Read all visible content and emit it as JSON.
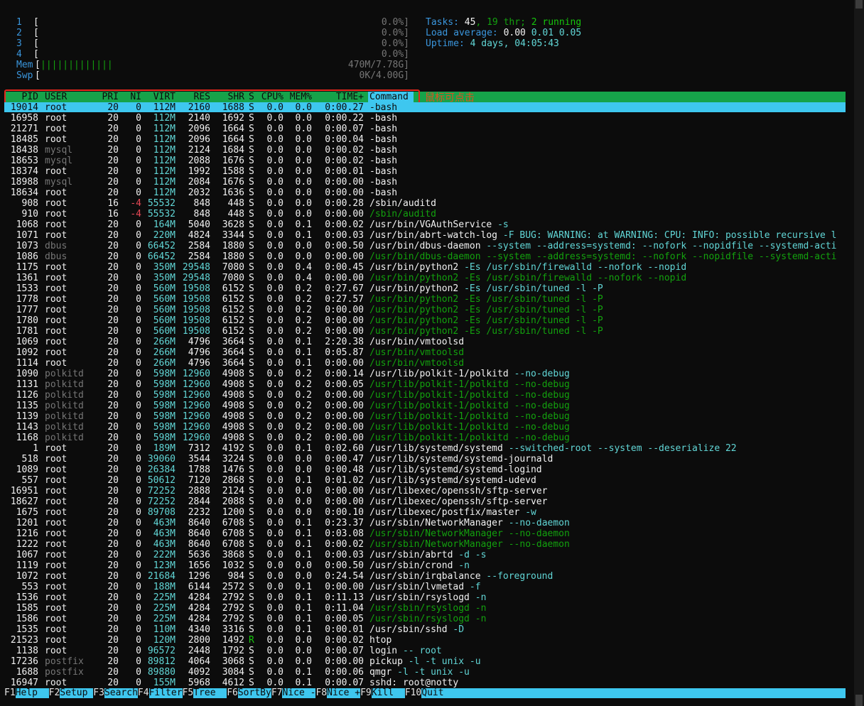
{
  "meters": {
    "cpu": [
      {
        "label": "1",
        "bar": "[",
        "value": "0.0%]"
      },
      {
        "label": "2",
        "bar": "[",
        "value": "0.0%]"
      },
      {
        "label": "3",
        "bar": "[",
        "value": "0.0%]"
      },
      {
        "label": "4",
        "bar": "[",
        "value": "0.0%]"
      }
    ],
    "mem": {
      "label": "Mem",
      "bar": "[",
      "fill": "|||||||||||||",
      "value": "470M/7.78G]"
    },
    "swp": {
      "label": "Swp",
      "bar": "[",
      "value": "0K/4.00G]"
    }
  },
  "stats": {
    "tasks_label": "Tasks: ",
    "tasks": "45",
    "thr": ", 19 thr;",
    "running": " 2 running",
    "load_label": "Load average: ",
    "load1": "0.00",
    "load5": "0.01",
    "load15": "0.05",
    "uptime_label": "Uptime: ",
    "uptime": "4 days, 04:05:43"
  },
  "columns": {
    "pid": "PID",
    "user": "USER",
    "pri": "PRI",
    "ni": "NI",
    "virt": "VIRT",
    "res": "RES",
    "shr": "SHR",
    "s": "S",
    "cpu": "CPU%",
    "mem": "MEM%",
    "time": "TIME+",
    "command": "Command"
  },
  "annotation": "鼠标可点击",
  "processes": [
    {
      "pid": "19014",
      "user": "root",
      "pri": "20",
      "ni": "0",
      "virt": "112M",
      "res": "2160",
      "shr": "1688",
      "s": "S",
      "cpu": "0.0",
      "mem": "0.0",
      "time": "0:00.27",
      "cmd": "-bash",
      "args": ""
    },
    {
      "pid": "16958",
      "user": "root",
      "pri": "20",
      "ni": "0",
      "virt": "112M",
      "res": "2140",
      "shr": "1692",
      "s": "S",
      "cpu": "0.0",
      "mem": "0.0",
      "time": "0:00.22",
      "cmd": "-bash",
      "args": ""
    },
    {
      "pid": "21271",
      "user": "root",
      "pri": "20",
      "ni": "0",
      "virt": "112M",
      "res": "2096",
      "shr": "1664",
      "s": "S",
      "cpu": "0.0",
      "mem": "0.0",
      "time": "0:00.07",
      "cmd": "-bash",
      "args": ""
    },
    {
      "pid": "18485",
      "user": "root",
      "pri": "20",
      "ni": "0",
      "virt": "112M",
      "res": "2096",
      "shr": "1664",
      "s": "S",
      "cpu": "0.0",
      "mem": "0.0",
      "time": "0:00.04",
      "cmd": "-bash",
      "args": ""
    },
    {
      "pid": "18438",
      "user": "mysql",
      "pri": "20",
      "ni": "0",
      "virt": "112M",
      "res": "2124",
      "shr": "1684",
      "s": "S",
      "cpu": "0.0",
      "mem": "0.0",
      "time": "0:00.02",
      "cmd": "-bash",
      "args": ""
    },
    {
      "pid": "18653",
      "user": "mysql",
      "pri": "20",
      "ni": "0",
      "virt": "112M",
      "res": "2088",
      "shr": "1676",
      "s": "S",
      "cpu": "0.0",
      "mem": "0.0",
      "time": "0:00.02",
      "cmd": "-bash",
      "args": ""
    },
    {
      "pid": "18374",
      "user": "root",
      "pri": "20",
      "ni": "0",
      "virt": "112M",
      "res": "1992",
      "shr": "1588",
      "s": "S",
      "cpu": "0.0",
      "mem": "0.0",
      "time": "0:00.01",
      "cmd": "-bash",
      "args": ""
    },
    {
      "pid": "18988",
      "user": "mysql",
      "pri": "20",
      "ni": "0",
      "virt": "112M",
      "res": "2084",
      "shr": "1676",
      "s": "S",
      "cpu": "0.0",
      "mem": "0.0",
      "time": "0:00.00",
      "cmd": "-bash",
      "args": ""
    },
    {
      "pid": "18634",
      "user": "root",
      "pri": "20",
      "ni": "0",
      "virt": "112M",
      "res": "2032",
      "shr": "1636",
      "s": "S",
      "cpu": "0.0",
      "mem": "0.0",
      "time": "0:00.00",
      "cmd": "-bash",
      "args": ""
    },
    {
      "pid": "908",
      "user": "root",
      "pri": "16",
      "ni": "-4",
      "virt": "55532",
      "res": "848",
      "shr": "448",
      "s": "S",
      "cpu": "0.0",
      "mem": "0.0",
      "time": "0:00.28",
      "cmd": "/sbin/auditd",
      "args": ""
    },
    {
      "pid": "910",
      "user": "root",
      "pri": "16",
      "ni": "-4",
      "virt": "55532",
      "res": "848",
      "shr": "448",
      "s": "S",
      "cpu": "0.0",
      "mem": "0.0",
      "time": "0:00.00",
      "cmd": "/sbin/auditd",
      "args": "",
      "thread": true
    },
    {
      "pid": "1068",
      "user": "root",
      "pri": "20",
      "ni": "0",
      "virt": "164M",
      "res": "5040",
      "shr": "3628",
      "s": "S",
      "cpu": "0.0",
      "mem": "0.1",
      "time": "0:00.02",
      "cmd": "/usr/bin/VGAuthService",
      "args": " -s"
    },
    {
      "pid": "1071",
      "user": "root",
      "pri": "20",
      "ni": "0",
      "virt": "220M",
      "res": "4824",
      "shr": "3344",
      "s": "S",
      "cpu": "0.0",
      "mem": "0.1",
      "time": "0:00.03",
      "cmd": "/usr/bin/abrt-watch-log",
      "args": " -F BUG: WARNING: at WARNING: CPU: INFO: possible recursive l"
    },
    {
      "pid": "1073",
      "user": "dbus",
      "pri": "20",
      "ni": "0",
      "virt": "66452",
      "res": "2584",
      "shr": "1880",
      "s": "S",
      "cpu": "0.0",
      "mem": "0.0",
      "time": "0:00.50",
      "cmd": "/usr/bin/dbus-daemon",
      "args": " --system --address=systemd: --nofork --nopidfile --systemd-acti"
    },
    {
      "pid": "1086",
      "user": "dbus",
      "pri": "20",
      "ni": "0",
      "virt": "66452",
      "res": "2584",
      "shr": "1880",
      "s": "S",
      "cpu": "0.0",
      "mem": "0.0",
      "time": "0:00.00",
      "cmd": "/usr/bin/dbus-daemon",
      "args": " --system --address=systemd: --nofork --nopidfile --systemd-acti",
      "thread": true
    },
    {
      "pid": "1175",
      "user": "root",
      "pri": "20",
      "ni": "0",
      "virt": "350M",
      "res": "29548",
      "shr": "7080",
      "s": "S",
      "cpu": "0.0",
      "mem": "0.4",
      "time": "0:00.45",
      "cmd": "/usr/bin/python2",
      "args": " -Es /usr/sbin/firewalld --nofork --nopid"
    },
    {
      "pid": "1361",
      "user": "root",
      "pri": "20",
      "ni": "0",
      "virt": "350M",
      "res": "29548",
      "shr": "7080",
      "s": "S",
      "cpu": "0.0",
      "mem": "0.4",
      "time": "0:00.00",
      "cmd": "/usr/bin/python2",
      "args": " -Es /usr/sbin/firewalld --nofork --nopid",
      "thread": true
    },
    {
      "pid": "1533",
      "user": "root",
      "pri": "20",
      "ni": "0",
      "virt": "560M",
      "res": "19508",
      "shr": "6152",
      "s": "S",
      "cpu": "0.0",
      "mem": "0.2",
      "time": "0:27.67",
      "cmd": "/usr/bin/python2",
      "args": " -Es /usr/sbin/tuned -l -P"
    },
    {
      "pid": "1778",
      "user": "root",
      "pri": "20",
      "ni": "0",
      "virt": "560M",
      "res": "19508",
      "shr": "6152",
      "s": "S",
      "cpu": "0.0",
      "mem": "0.2",
      "time": "0:27.57",
      "cmd": "/usr/bin/python2",
      "args": " -Es /usr/sbin/tuned -l -P",
      "thread": true
    },
    {
      "pid": "1777",
      "user": "root",
      "pri": "20",
      "ni": "0",
      "virt": "560M",
      "res": "19508",
      "shr": "6152",
      "s": "S",
      "cpu": "0.0",
      "mem": "0.2",
      "time": "0:00.00",
      "cmd": "/usr/bin/python2",
      "args": " -Es /usr/sbin/tuned -l -P",
      "thread": true
    },
    {
      "pid": "1780",
      "user": "root",
      "pri": "20",
      "ni": "0",
      "virt": "560M",
      "res": "19508",
      "shr": "6152",
      "s": "S",
      "cpu": "0.0",
      "mem": "0.2",
      "time": "0:00.00",
      "cmd": "/usr/bin/python2",
      "args": " -Es /usr/sbin/tuned -l -P",
      "thread": true
    },
    {
      "pid": "1781",
      "user": "root",
      "pri": "20",
      "ni": "0",
      "virt": "560M",
      "res": "19508",
      "shr": "6152",
      "s": "S",
      "cpu": "0.0",
      "mem": "0.2",
      "time": "0:00.00",
      "cmd": "/usr/bin/python2",
      "args": " -Es /usr/sbin/tuned -l -P",
      "thread": true
    },
    {
      "pid": "1069",
      "user": "root",
      "pri": "20",
      "ni": "0",
      "virt": "266M",
      "res": "4796",
      "shr": "3664",
      "s": "S",
      "cpu": "0.0",
      "mem": "0.1",
      "time": "2:20.38",
      "cmd": "/usr/bin/vmtoolsd",
      "args": ""
    },
    {
      "pid": "1092",
      "user": "root",
      "pri": "20",
      "ni": "0",
      "virt": "266M",
      "res": "4796",
      "shr": "3664",
      "s": "S",
      "cpu": "0.0",
      "mem": "0.1",
      "time": "0:05.87",
      "cmd": "/usr/bin/vmtoolsd",
      "args": "",
      "thread": true
    },
    {
      "pid": "1114",
      "user": "root",
      "pri": "20",
      "ni": "0",
      "virt": "266M",
      "res": "4796",
      "shr": "3664",
      "s": "S",
      "cpu": "0.0",
      "mem": "0.1",
      "time": "0:00.00",
      "cmd": "/usr/bin/vmtoolsd",
      "args": "",
      "thread": true
    },
    {
      "pid": "1090",
      "user": "polkitd",
      "pri": "20",
      "ni": "0",
      "virt": "598M",
      "res": "12960",
      "shr": "4908",
      "s": "S",
      "cpu": "0.0",
      "mem": "0.2",
      "time": "0:00.14",
      "cmd": "/usr/lib/polkit-1/polkitd",
      "args": " --no-debug"
    },
    {
      "pid": "1131",
      "user": "polkitd",
      "pri": "20",
      "ni": "0",
      "virt": "598M",
      "res": "12960",
      "shr": "4908",
      "s": "S",
      "cpu": "0.0",
      "mem": "0.2",
      "time": "0:00.05",
      "cmd": "/usr/lib/polkit-1/polkitd",
      "args": " --no-debug",
      "thread": true
    },
    {
      "pid": "1126",
      "user": "polkitd",
      "pri": "20",
      "ni": "0",
      "virt": "598M",
      "res": "12960",
      "shr": "4908",
      "s": "S",
      "cpu": "0.0",
      "mem": "0.2",
      "time": "0:00.00",
      "cmd": "/usr/lib/polkit-1/polkitd",
      "args": " --no-debug",
      "thread": true
    },
    {
      "pid": "1135",
      "user": "polkitd",
      "pri": "20",
      "ni": "0",
      "virt": "598M",
      "res": "12960",
      "shr": "4908",
      "s": "S",
      "cpu": "0.0",
      "mem": "0.2",
      "time": "0:00.00",
      "cmd": "/usr/lib/polkit-1/polkitd",
      "args": " --no-debug",
      "thread": true
    },
    {
      "pid": "1139",
      "user": "polkitd",
      "pri": "20",
      "ni": "0",
      "virt": "598M",
      "res": "12960",
      "shr": "4908",
      "s": "S",
      "cpu": "0.0",
      "mem": "0.2",
      "time": "0:00.00",
      "cmd": "/usr/lib/polkit-1/polkitd",
      "args": " --no-debug",
      "thread": true
    },
    {
      "pid": "1143",
      "user": "polkitd",
      "pri": "20",
      "ni": "0",
      "virt": "598M",
      "res": "12960",
      "shr": "4908",
      "s": "S",
      "cpu": "0.0",
      "mem": "0.2",
      "time": "0:00.00",
      "cmd": "/usr/lib/polkit-1/polkitd",
      "args": " --no-debug",
      "thread": true
    },
    {
      "pid": "1168",
      "user": "polkitd",
      "pri": "20",
      "ni": "0",
      "virt": "598M",
      "res": "12960",
      "shr": "4908",
      "s": "S",
      "cpu": "0.0",
      "mem": "0.2",
      "time": "0:00.00",
      "cmd": "/usr/lib/polkit-1/polkitd",
      "args": " --no-debug",
      "thread": true
    },
    {
      "pid": "1",
      "user": "root",
      "pri": "20",
      "ni": "0",
      "virt": "189M",
      "res": "7312",
      "shr": "4192",
      "s": "S",
      "cpu": "0.0",
      "mem": "0.1",
      "time": "0:02.60",
      "cmd": "/usr/lib/systemd/systemd",
      "args": " --switched-root --system --deserialize 22"
    },
    {
      "pid": "518",
      "user": "root",
      "pri": "20",
      "ni": "0",
      "virt": "39060",
      "res": "3544",
      "shr": "3224",
      "s": "S",
      "cpu": "0.0",
      "mem": "0.0",
      "time": "0:00.47",
      "cmd": "/usr/lib/systemd/systemd-journald",
      "args": ""
    },
    {
      "pid": "1089",
      "user": "root",
      "pri": "20",
      "ni": "0",
      "virt": "26384",
      "res": "1788",
      "shr": "1476",
      "s": "S",
      "cpu": "0.0",
      "mem": "0.0",
      "time": "0:00.48",
      "cmd": "/usr/lib/systemd/systemd-logind",
      "args": ""
    },
    {
      "pid": "557",
      "user": "root",
      "pri": "20",
      "ni": "0",
      "virt": "50612",
      "res": "7120",
      "shr": "2868",
      "s": "S",
      "cpu": "0.0",
      "mem": "0.1",
      "time": "0:01.02",
      "cmd": "/usr/lib/systemd/systemd-udevd",
      "args": ""
    },
    {
      "pid": "16951",
      "user": "root",
      "pri": "20",
      "ni": "0",
      "virt": "72252",
      "res": "2888",
      "shr": "2124",
      "s": "S",
      "cpu": "0.0",
      "mem": "0.0",
      "time": "0:00.00",
      "cmd": "/usr/libexec/openssh/sftp-server",
      "args": ""
    },
    {
      "pid": "18627",
      "user": "root",
      "pri": "20",
      "ni": "0",
      "virt": "72252",
      "res": "2844",
      "shr": "2088",
      "s": "S",
      "cpu": "0.0",
      "mem": "0.0",
      "time": "0:00.00",
      "cmd": "/usr/libexec/openssh/sftp-server",
      "args": ""
    },
    {
      "pid": "1675",
      "user": "root",
      "pri": "20",
      "ni": "0",
      "virt": "89708",
      "res": "2232",
      "shr": "1200",
      "s": "S",
      "cpu": "0.0",
      "mem": "0.0",
      "time": "0:00.10",
      "cmd": "/usr/libexec/postfix/master",
      "args": " -w"
    },
    {
      "pid": "1201",
      "user": "root",
      "pri": "20",
      "ni": "0",
      "virt": "463M",
      "res": "8640",
      "shr": "6708",
      "s": "S",
      "cpu": "0.0",
      "mem": "0.1",
      "time": "0:23.37",
      "cmd": "/usr/sbin/NetworkManager",
      "args": " --no-daemon"
    },
    {
      "pid": "1216",
      "user": "root",
      "pri": "20",
      "ni": "0",
      "virt": "463M",
      "res": "8640",
      "shr": "6708",
      "s": "S",
      "cpu": "0.0",
      "mem": "0.1",
      "time": "0:03.08",
      "cmd": "/usr/sbin/NetworkManager",
      "args": " --no-daemon",
      "thread": true
    },
    {
      "pid": "1222",
      "user": "root",
      "pri": "20",
      "ni": "0",
      "virt": "463M",
      "res": "8640",
      "shr": "6708",
      "s": "S",
      "cpu": "0.0",
      "mem": "0.1",
      "time": "0:00.02",
      "cmd": "/usr/sbin/NetworkManager",
      "args": " --no-daemon",
      "thread": true
    },
    {
      "pid": "1067",
      "user": "root",
      "pri": "20",
      "ni": "0",
      "virt": "222M",
      "res": "5636",
      "shr": "3868",
      "s": "S",
      "cpu": "0.0",
      "mem": "0.1",
      "time": "0:00.03",
      "cmd": "/usr/sbin/abrtd",
      "args": " -d -s"
    },
    {
      "pid": "1119",
      "user": "root",
      "pri": "20",
      "ni": "0",
      "virt": "123M",
      "res": "1656",
      "shr": "1032",
      "s": "S",
      "cpu": "0.0",
      "mem": "0.0",
      "time": "0:00.50",
      "cmd": "/usr/sbin/crond",
      "args": " -n"
    },
    {
      "pid": "1072",
      "user": "root",
      "pri": "20",
      "ni": "0",
      "virt": "21684",
      "res": "1296",
      "shr": "984",
      "s": "S",
      "cpu": "0.0",
      "mem": "0.0",
      "time": "0:24.54",
      "cmd": "/usr/sbin/irqbalance",
      "args": " --foreground"
    },
    {
      "pid": "553",
      "user": "root",
      "pri": "20",
      "ni": "0",
      "virt": "188M",
      "res": "6144",
      "shr": "2572",
      "s": "S",
      "cpu": "0.0",
      "mem": "0.1",
      "time": "0:00.00",
      "cmd": "/usr/sbin/lvmetad",
      "args": " -f"
    },
    {
      "pid": "1536",
      "user": "root",
      "pri": "20",
      "ni": "0",
      "virt": "225M",
      "res": "4284",
      "shr": "2792",
      "s": "S",
      "cpu": "0.0",
      "mem": "0.1",
      "time": "0:11.13",
      "cmd": "/usr/sbin/rsyslogd",
      "args": " -n"
    },
    {
      "pid": "1585",
      "user": "root",
      "pri": "20",
      "ni": "0",
      "virt": "225M",
      "res": "4284",
      "shr": "2792",
      "s": "S",
      "cpu": "0.0",
      "mem": "0.1",
      "time": "0:11.04",
      "cmd": "/usr/sbin/rsyslogd",
      "args": " -n",
      "thread": true
    },
    {
      "pid": "1586",
      "user": "root",
      "pri": "20",
      "ni": "0",
      "virt": "225M",
      "res": "4284",
      "shr": "2792",
      "s": "S",
      "cpu": "0.0",
      "mem": "0.1",
      "time": "0:00.05",
      "cmd": "/usr/sbin/rsyslogd",
      "args": " -n",
      "thread": true
    },
    {
      "pid": "1535",
      "user": "root",
      "pri": "20",
      "ni": "0",
      "virt": "110M",
      "res": "4340",
      "shr": "3316",
      "s": "S",
      "cpu": "0.0",
      "mem": "0.1",
      "time": "0:00.01",
      "cmd": "/usr/sbin/sshd",
      "args": " -D"
    },
    {
      "pid": "21523",
      "user": "root",
      "pri": "20",
      "ni": "0",
      "virt": "120M",
      "res": "2800",
      "shr": "1492",
      "s": "R",
      "cpu": "0.0",
      "mem": "0.0",
      "time": "0:00.02",
      "cmd": "htop",
      "args": ""
    },
    {
      "pid": "1138",
      "user": "root",
      "pri": "20",
      "ni": "0",
      "virt": "96572",
      "res": "2448",
      "shr": "1792",
      "s": "S",
      "cpu": "0.0",
      "mem": "0.0",
      "time": "0:00.07",
      "cmd": "login",
      "args": " -- root"
    },
    {
      "pid": "17236",
      "user": "postfix",
      "pri": "20",
      "ni": "0",
      "virt": "89812",
      "res": "4064",
      "shr": "3068",
      "s": "S",
      "cpu": "0.0",
      "mem": "0.0",
      "time": "0:00.00",
      "cmd": "pickup",
      "args": " -l -t unix -u"
    },
    {
      "pid": "1688",
      "user": "postfix",
      "pri": "20",
      "ni": "0",
      "virt": "89880",
      "res": "4092",
      "shr": "3084",
      "s": "S",
      "cpu": "0.0",
      "mem": "0.1",
      "time": "0:00.06",
      "cmd": "qmgr",
      "args": " -l -t unix -u"
    },
    {
      "pid": "16947",
      "user": "root",
      "pri": "20",
      "ni": "0",
      "virt": "155M",
      "res": "5968",
      "shr": "4612",
      "s": "S",
      "cpu": "0.0",
      "mem": "0.1",
      "time": "0:00.07",
      "cmd": "sshd: root@notty",
      "args": ""
    }
  ],
  "fkeys": [
    {
      "key": "F1",
      "label": "Help  "
    },
    {
      "key": "F2",
      "label": "Setup "
    },
    {
      "key": "F3",
      "label": "Search"
    },
    {
      "key": "F4",
      "label": "Filter"
    },
    {
      "key": "F5",
      "label": "Tree  "
    },
    {
      "key": "F6",
      "label": "SortBy"
    },
    {
      "key": "F7",
      "label": "Nice -"
    },
    {
      "key": "F8",
      "label": "Nice +"
    },
    {
      "key": "F9",
      "label": "Kill  "
    },
    {
      "key": "F10",
      "label": "Quit  "
    }
  ],
  "colors": {
    "header_bg": "#16a34a",
    "selected_bg": "#3ec7ef",
    "annotation": "#e5271d"
  }
}
